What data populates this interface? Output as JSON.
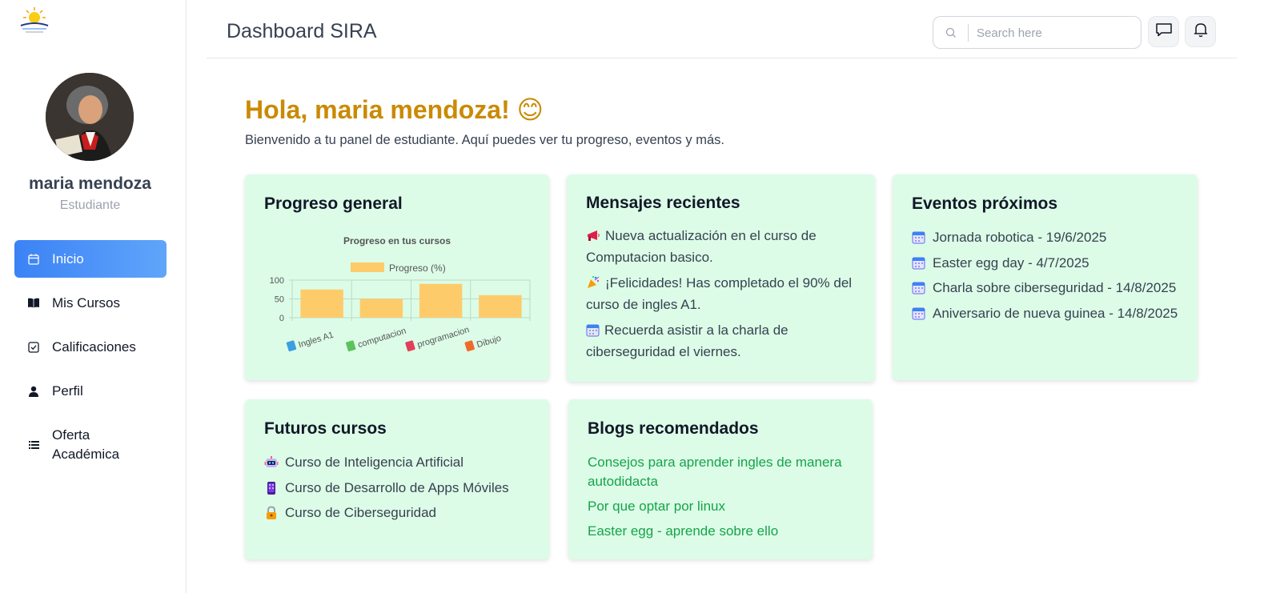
{
  "header": {
    "title": "Dashboard SIRA",
    "search_placeholder": "Search here"
  },
  "user": {
    "name": "maria mendoza",
    "role": "Estudiante"
  },
  "sidebar": {
    "items": [
      {
        "label": "Inicio",
        "icon": "calendar-icon",
        "active": true
      },
      {
        "label": "Mis Cursos",
        "icon": "book-open-icon",
        "active": false
      },
      {
        "label": "Calificaciones",
        "icon": "checkbox-icon",
        "active": false
      },
      {
        "label": "Perfil",
        "icon": "user-icon",
        "active": false
      },
      {
        "label": "Oferta Académica",
        "icon": "list-icon",
        "active": false
      }
    ]
  },
  "main": {
    "greeting": "Hola, maria mendoza! 😊",
    "subtitle": "Bienvenido a tu panel de estudiante. Aquí puedes ver tu progreso, eventos y más."
  },
  "cards": {
    "progress": {
      "title": "Progreso general"
    },
    "messages": {
      "title": "Mensajes recientes",
      "items": [
        {
          "icon": "megaphone-icon",
          "text": "Nueva actualización en el curso de Computacion basico."
        },
        {
          "icon": "party-popper-icon",
          "text": "¡Felicidades! Has completado el 90% del curso de ingles A1."
        },
        {
          "icon": "calendar-icon",
          "text": "Recuerda asistir a la charla de ciberseguridad el viernes."
        }
      ]
    },
    "events": {
      "title": "Eventos próximos",
      "items": [
        {
          "icon": "calendar-icon",
          "text": "Jornada robotica - 19/6/2025"
        },
        {
          "icon": "calendar-icon",
          "text": "Easter egg day - 4/7/2025"
        },
        {
          "icon": "calendar-icon",
          "text": "Charla sobre ciberseguridad - 14/8/2025"
        },
        {
          "icon": "calendar-icon",
          "text": "Aniversario de nueva guinea - 14/8/2025"
        }
      ]
    },
    "future": {
      "title": "Futuros cursos",
      "items": [
        {
          "icon": "robot-icon",
          "text": "Curso de Inteligencia Artificial"
        },
        {
          "icon": "mobile-phone-icon",
          "text": "Curso de Desarrollo de Apps Móviles"
        },
        {
          "icon": "lock-icon",
          "text": "Curso de Ciberseguridad"
        }
      ]
    },
    "blogs": {
      "title": "Blogs recomendados",
      "items": [
        {
          "text": "Consejos para aprender ingles de manera autodidacta"
        },
        {
          "text": "Por que optar por linux"
        },
        {
          "text": "Easter egg - aprende sobre ello"
        }
      ]
    }
  },
  "colors": {
    "accent_blue": "#3b82f6",
    "greeting_gold": "#ca8a04",
    "card_bg": "#dcfce7",
    "link_green": "#16a34a",
    "bar_fill": "#fecb6b"
  },
  "chart_data": {
    "type": "bar",
    "title": "Progreso en tus cursos",
    "categories": [
      "Ingles A1",
      "computacion",
      "programacion",
      "Dibujo"
    ],
    "category_icons": [
      "blue-book-icon",
      "green-book-icon",
      "red-book-icon",
      "orange-book-icon"
    ],
    "series": [
      {
        "name": "Progreso (%)",
        "values": [
          75,
          50,
          90,
          60
        ]
      }
    ],
    "ylim": [
      0,
      100
    ],
    "yticks": [
      0,
      50,
      100
    ],
    "grid": true,
    "legend": "top-center"
  }
}
